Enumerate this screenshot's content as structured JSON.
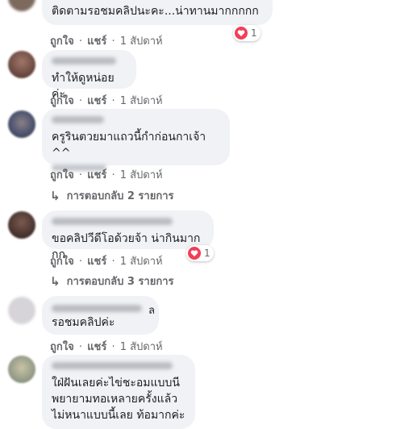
{
  "comments": [
    {
      "text": "ติดตามรอชมคลิปนะคะ...น่าทานมากกกกก",
      "like": "ถูกใจ",
      "share": "แชร์",
      "time": "1 สัปดาห์",
      "reaction_count": "1"
    },
    {
      "text": "ทำให้ดูหน่อยค่ะ",
      "like": "ถูกใจ",
      "share": "แชร์",
      "time": "1 สัปดาห์"
    },
    {
      "text": "ครูรินตวยมาแถวนี้กำก่อนกาเจ้า ^^",
      "like": "ถูกใจ",
      "share": "แชร์",
      "time": "1 สัปดาห์",
      "replies": "การตอบกลับ 2 รายการ"
    },
    {
      "text": "ขอคลิปวีดีโอด้วยจ้า น่ากินมากกก",
      "like": "ถูกใจ",
      "share": "แชร์",
      "time": "1 สัปดาห์",
      "reaction_count": "1",
      "replies": "การตอบกลับ 3 รายการ"
    },
    {
      "text_suffix": "ล",
      "text": "รอชมคลิปค่ะ",
      "like": "ถูกใจ",
      "share": "แชร์",
      "time": "1 สัปดาห์"
    },
    {
      "text": "ใฝ่ฝันเลยค่ะไข่ชะอมแบบนี\nพยายามทอเหลายครั้งแล้ว\nไม่หนาแบบนี้เลย ท้อมากค่ะ"
    }
  ],
  "colors": {
    "bubble": "#f0f2f5",
    "meta_text": "#65676b",
    "heart": "#f33e58"
  },
  "icons": [
    "heart-reaction-icon",
    "reply-arrow-icon",
    "avatar"
  ]
}
